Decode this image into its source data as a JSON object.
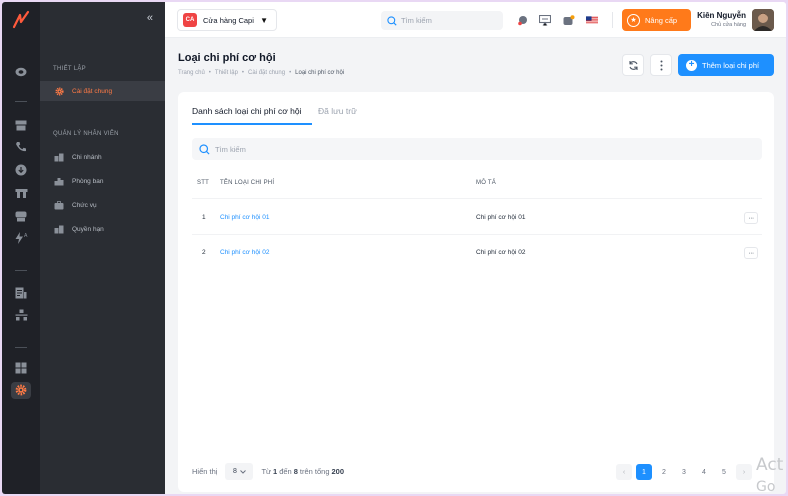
{
  "sidebar": {
    "section_settings": "THIẾT LẬP",
    "item_general": "Cài đặt chung",
    "section_staff": "QUẢN LÝ NHÂN VIÊN",
    "items": [
      {
        "label": "Chi nhánh"
      },
      {
        "label": "Phòng ban"
      },
      {
        "label": "Chức vụ"
      },
      {
        "label": "Quyền hạn"
      }
    ]
  },
  "header": {
    "store_badge": "CA",
    "store_name": "Cửa hàng Capi",
    "search_placeholder": "Tìm kiếm",
    "upgrade_label": "Nâng cấp",
    "user_name": "Kiên Nguyễn",
    "user_role": "Chủ cửa hàng"
  },
  "page": {
    "title": "Loại chi phí cơ hội",
    "breadcrumb": [
      "Trang chủ",
      "Thiết lập",
      "Cài đặt chung",
      "Loại chi phí cơ hội"
    ],
    "add_button": "Thêm loại chi phí"
  },
  "tabs": {
    "list": "Danh sách loại chi phí cơ hội",
    "archived": "Đã lưu trữ"
  },
  "table": {
    "search_placeholder": "Tìm kiếm",
    "headers": {
      "stt": "STT",
      "name": "TÊN LOẠI CHI PHÍ",
      "desc": "MÔ TẢ"
    },
    "rows": [
      {
        "stt": "1",
        "name": "Chi phí cơ hội 01",
        "desc": "Chi phí cơ hội 01"
      },
      {
        "stt": "2",
        "name": "Chi phí cơ hội 02",
        "desc": "Chi phí cơ hội 02"
      }
    ]
  },
  "footer": {
    "show_label": "Hiển thị",
    "page_size": "8",
    "range_prefix": "Từ",
    "range_from": "1",
    "range_mid": "đến",
    "range_to": "8",
    "range_total_label": "trên tổng",
    "range_total": "200",
    "pages": [
      "1",
      "2",
      "3",
      "4",
      "5"
    ],
    "current_page": "1"
  },
  "watermark": {
    "line1": "Act",
    "line2": "Go to"
  },
  "colors": {
    "accent": "#1e90ff",
    "upgrade": "#ff7a1a",
    "sidebar_active": "#ff7a45",
    "rail": "#1f2127",
    "sidebar": "#2a2d33"
  }
}
